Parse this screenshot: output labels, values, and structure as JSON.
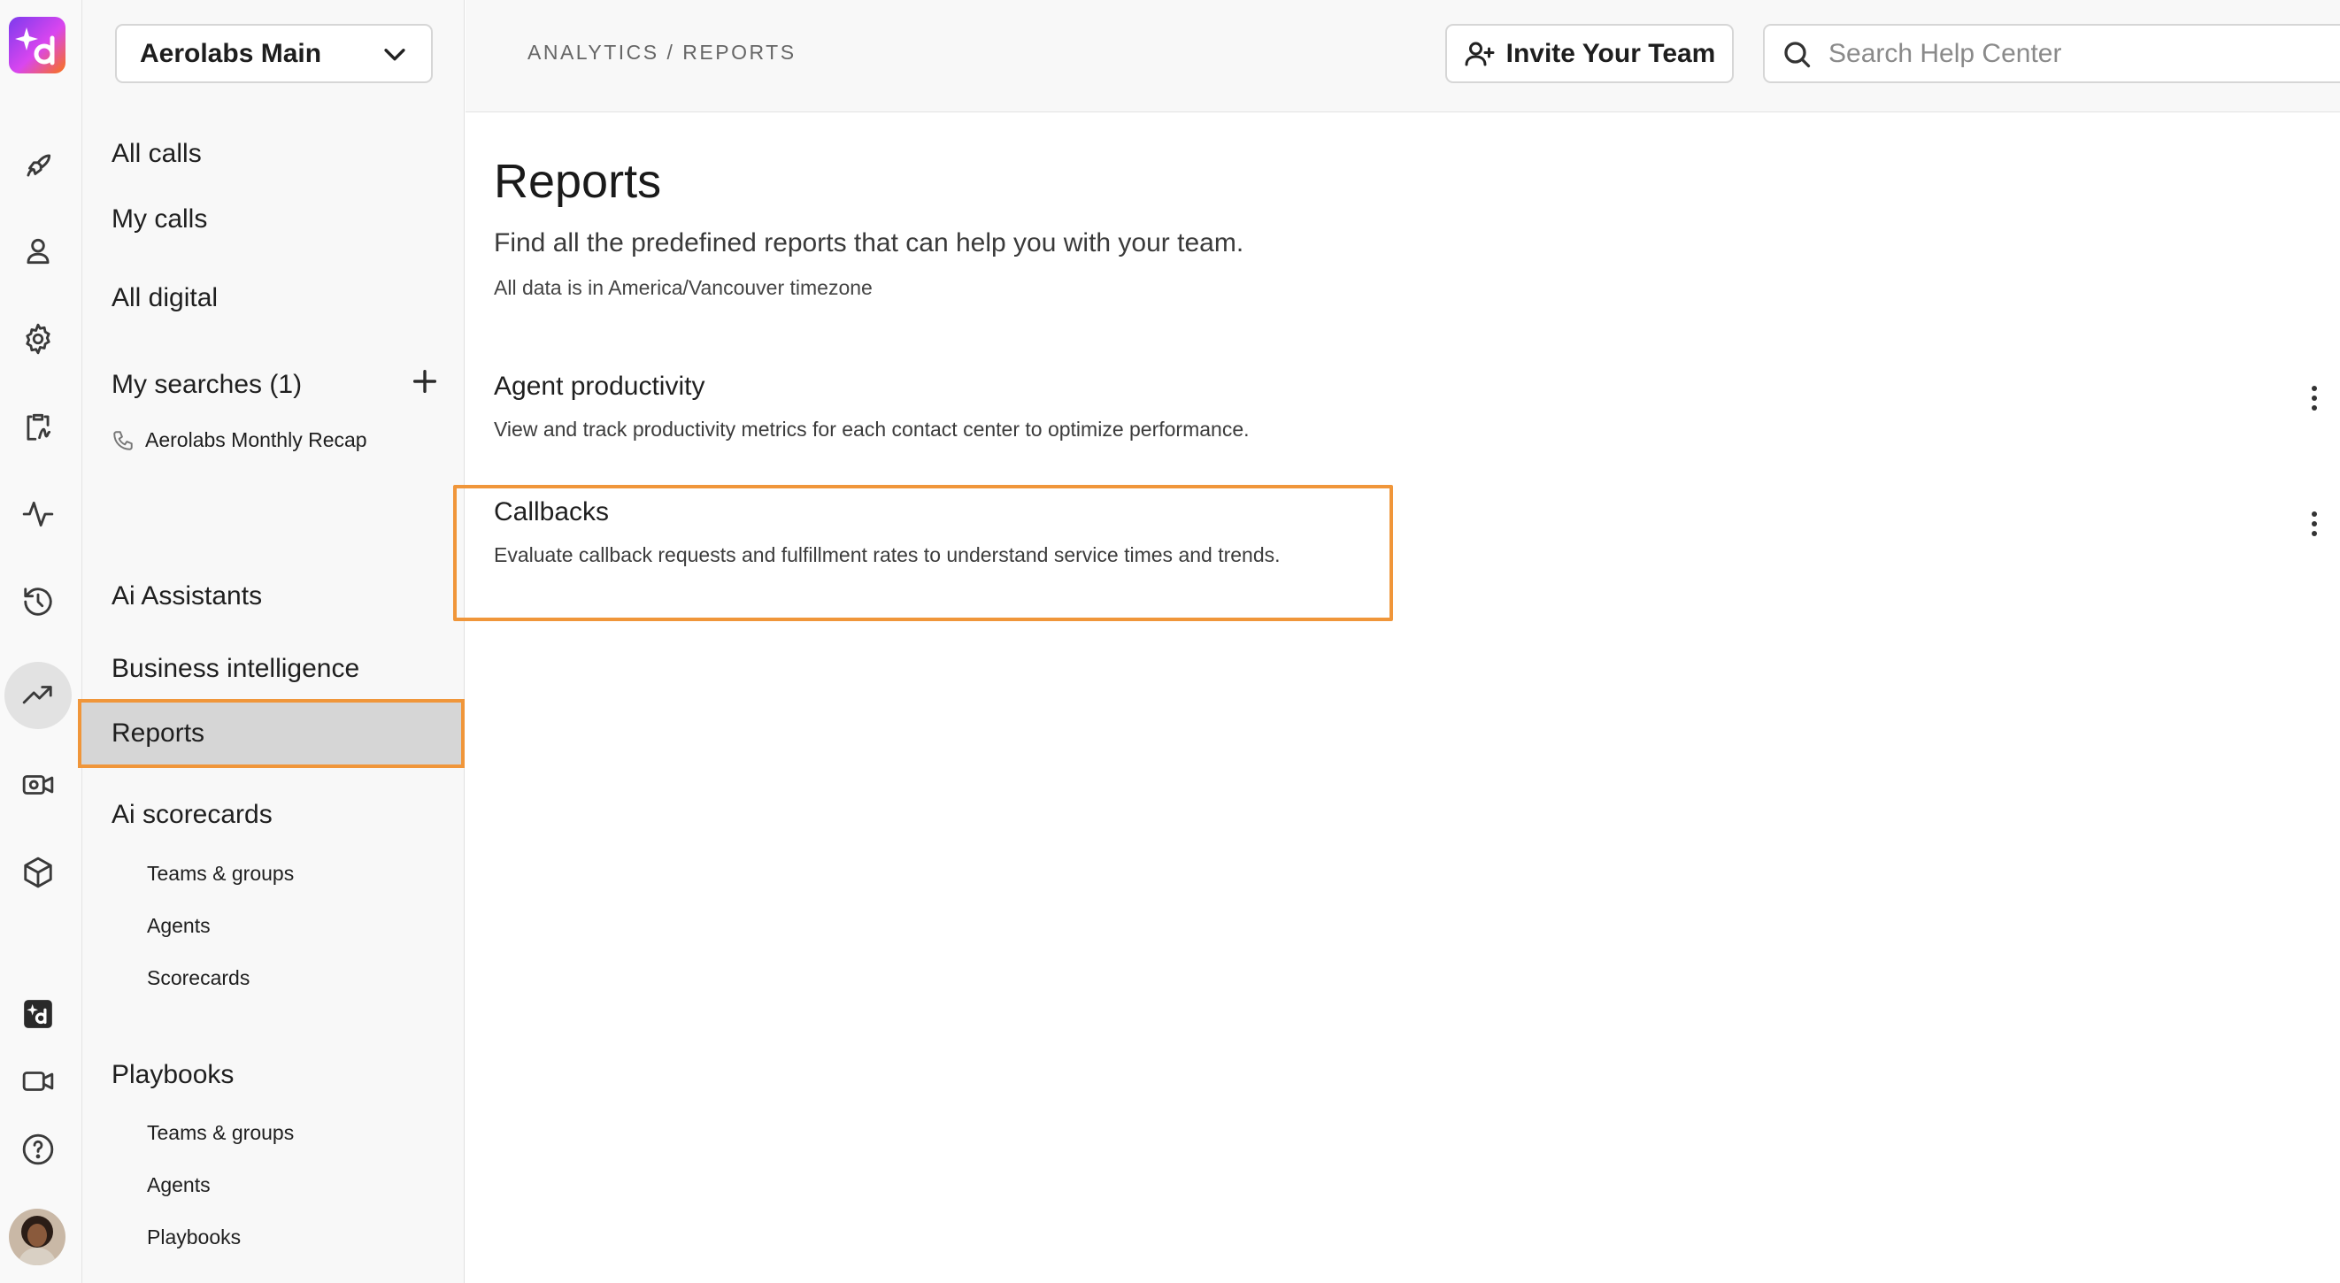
{
  "workspace": {
    "name": "Aerolabs Main"
  },
  "breadcrumb": "ANALYTICS / REPORTS",
  "topbar": {
    "invite_label": "Invite Your Team",
    "search_placeholder": "Search Help Center"
  },
  "rail": {
    "icons": [
      "rocket-icon",
      "user-icon",
      "gear-icon",
      "clipboard-icon",
      "activity-icon",
      "history-icon",
      "trending-up-icon",
      "video-settings-icon",
      "cube-icon",
      "dialpad-ai-icon",
      "video-icon",
      "help-icon"
    ],
    "active": "trending-up-icon"
  },
  "sidebar": {
    "all_calls": "All calls",
    "my_calls": "My calls",
    "all_digital": "All digital",
    "my_searches": "My searches (1)",
    "saved_search": "Aerolabs Monthly Recap",
    "ai_assistants": "Ai Assistants",
    "business_intelligence": "Business intelligence",
    "reports": "Reports",
    "ai_scorecards": "Ai scorecards",
    "scorecards_sub": [
      "Teams & groups",
      "Agents",
      "Scorecards"
    ],
    "playbooks": "Playbooks",
    "playbooks_sub": [
      "Teams & groups",
      "Agents",
      "Playbooks"
    ]
  },
  "main": {
    "title": "Reports",
    "description": "Find all the predefined reports that can help you with your team.",
    "timezone_note": "All data is in America/Vancouver timezone",
    "reports": [
      {
        "title": "Agent productivity",
        "description": "View and track productivity metrics for each contact center to optimize performance."
      },
      {
        "title": "Callbacks",
        "description": "Evaluate callback requests and fulfillment rates to understand service times and trends."
      }
    ]
  },
  "colors": {
    "highlight": "#f0963a",
    "active_bg": "#d6d6d6",
    "brand_gradient": [
      "#7c3aed",
      "#d946ef",
      "#f97316"
    ]
  }
}
